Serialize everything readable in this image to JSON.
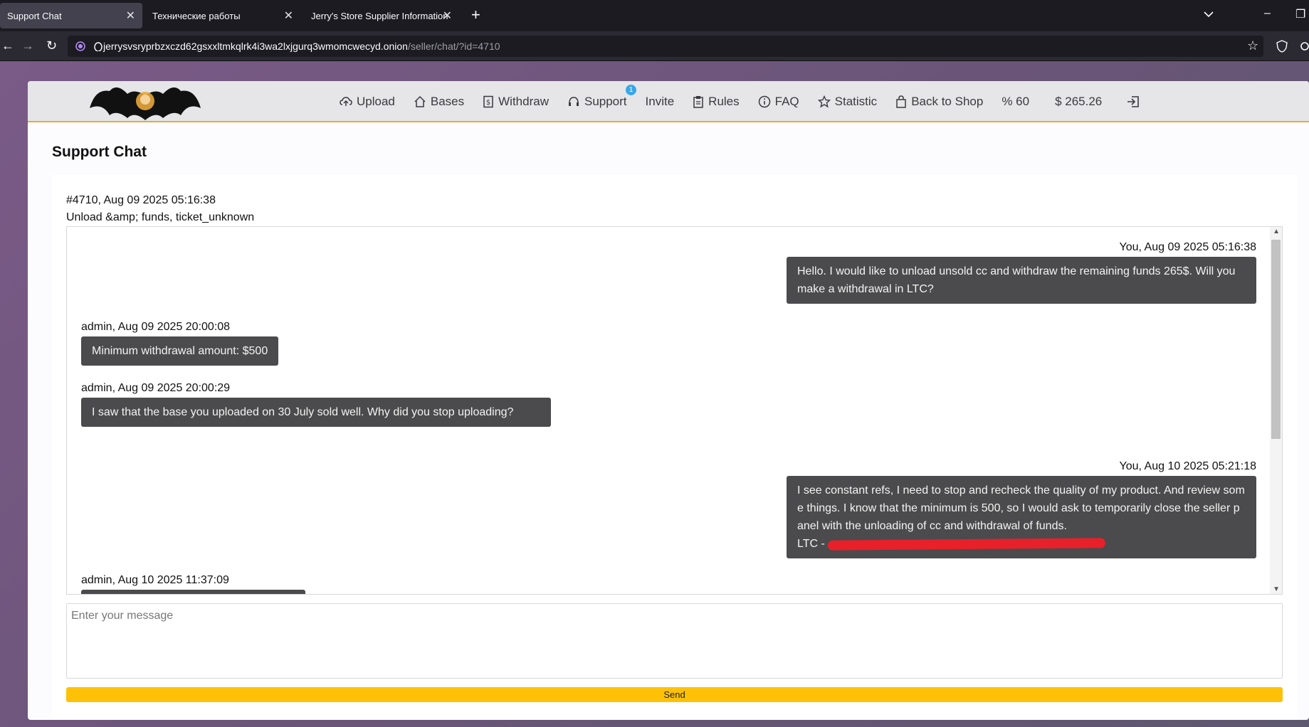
{
  "browser": {
    "tabs": [
      {
        "label": "Support Chat",
        "active": true
      },
      {
        "label": "Технические работы",
        "active": false
      },
      {
        "label": "Jerry's Store Supplier Information",
        "active": false
      }
    ],
    "url_host": "jerrysvsryprbzxczd62gsxxltmkqlrk4i3wa2lxjgurq3wmomcwecyd.onion",
    "url_path": "/seller/chat/?id=4710"
  },
  "header": {
    "menu": [
      {
        "label": "Upload",
        "icon": "cloud-upload-icon"
      },
      {
        "label": "Bases",
        "icon": "home-icon"
      },
      {
        "label": "Withdraw",
        "icon": "dollar-doc-icon"
      },
      {
        "label": "Support",
        "icon": "headset-icon",
        "badge": "1"
      },
      {
        "label": "Invite",
        "icon": ""
      },
      {
        "label": "Rules",
        "icon": "clipboard-icon"
      },
      {
        "label": "FAQ",
        "icon": "info-icon"
      },
      {
        "label": "Statistic",
        "icon": "star-icon"
      },
      {
        "label": "Back to Shop",
        "icon": "bag-icon"
      }
    ],
    "percent": "% 60",
    "balance": "$ 265.26",
    "accent_color": "#e9a73a"
  },
  "page": {
    "title": "Support Chat",
    "ticket_line1": "#4710, Aug 09 2025 05:16:38",
    "ticket_line2": "Unload &amp; funds, ticket_unknown"
  },
  "messages": [
    {
      "side": "right",
      "meta": "You, Aug 09 2025 05:16:38",
      "text": "Hello. I would like to unload unsold cc and withdraw the remaining funds 265$. Will you make a withdrawal in LTC?"
    },
    {
      "side": "left",
      "meta": "admin, Aug 09 2025 20:00:08",
      "text": "Minimum withdrawal amount: $500"
    },
    {
      "side": "left",
      "meta": "admin, Aug 09 2025 20:00:29",
      "text": "I saw that the base you uploaded on 30 July sold well. Why did you stop uploading?"
    },
    {
      "side": "right",
      "meta": "You, Aug 10 2025 05:21:18",
      "text": "I see constant refs, I need to stop and recheck the quality of my product. And review some things. I know that the minimum is 500, so I would ask to temporarily close the seller panel with the unloading of cc and withdrawal of funds.",
      "ltc_prefix": "LTC - "
    },
    {
      "side": "left",
      "meta": "admin, Aug 10 2025 11:37:09",
      "text": ""
    }
  ],
  "composer": {
    "placeholder": "Enter your message",
    "send_label": "Send",
    "send_color": "#ffc107"
  }
}
